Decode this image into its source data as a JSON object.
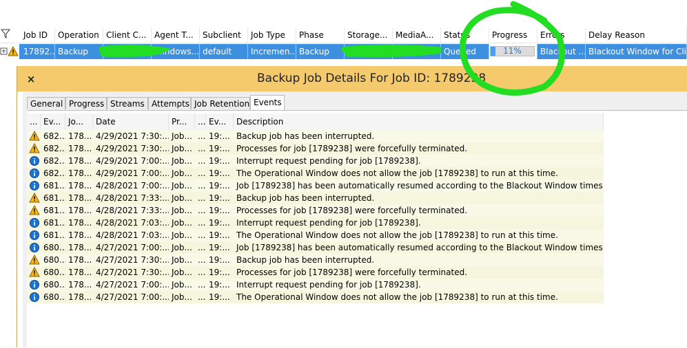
{
  "grid": {
    "columns": [
      "Job ID",
      "Operation",
      "Client C...",
      "Agent T...",
      "Subclient",
      "Job Type",
      "Phase",
      "Storage...",
      "MediaA...",
      "Status",
      "Progress",
      "Errors",
      "Delay Reason"
    ],
    "row": {
      "job_id": "17892...",
      "operation": "Backup",
      "client": "",
      "agent_type": "Windows...",
      "subclient": "default",
      "job_type": "Incremen...",
      "phase": "Backup",
      "storage": "",
      "media_agent": "",
      "status": "Queued",
      "progress": "11%",
      "progress_value": 11,
      "errors": "Blackout ...",
      "delay_reason": "Blackout Window for Client"
    }
  },
  "dialog": {
    "title": "Backup Job Details For Job ID: 1789238",
    "close": "×",
    "tabs": [
      "General",
      "Progress",
      "Streams",
      "Attempts",
      "Job Retention",
      "Events"
    ],
    "active_tab": "Events"
  },
  "events": {
    "columns": [
      "...",
      "Ev...",
      "Jo...",
      "Date",
      "Pr...",
      "...",
      "Ev...",
      "Description"
    ],
    "rows": [
      {
        "sev": "warning",
        "id": "682...",
        "job": "178...",
        "date": "4/29/2021 7:30:...",
        "proc": "Job...",
        "x": "...",
        "ev": "19:...",
        "desc": "Backup job has been interrupted."
      },
      {
        "sev": "warning",
        "id": "682...",
        "job": "178...",
        "date": "4/29/2021 7:30:...",
        "proc": "Job...",
        "x": "...",
        "ev": "19:...",
        "desc": "Processes for job [1789238] were forcefully terminated."
      },
      {
        "sev": "info",
        "id": "682...",
        "job": "178...",
        "date": "4/29/2021 7:00:...",
        "proc": "Job...",
        "x": "...",
        "ev": "19:...",
        "desc": "Interrupt request pending for job [1789238]."
      },
      {
        "sev": "info",
        "id": "682...",
        "job": "178...",
        "date": "4/29/2021 7:00:...",
        "proc": "Job...",
        "x": "...",
        "ev": "19:...",
        "desc": "The Operational Window does not allow the job [1789238] to run at this time."
      },
      {
        "sev": "info",
        "id": "681...",
        "job": "178...",
        "date": "4/28/2021 7:00:...",
        "proc": "Job...",
        "x": "...",
        "ev": "19:...",
        "desc": "Job [1789238] has been automatically resumed according to the Blackout Window times. ..."
      },
      {
        "sev": "warning",
        "id": "681...",
        "job": "178...",
        "date": "4/28/2021 7:33:...",
        "proc": "Job...",
        "x": "...",
        "ev": "19:...",
        "desc": "Backup job has been interrupted."
      },
      {
        "sev": "warning",
        "id": "681...",
        "job": "178...",
        "date": "4/28/2021 7:33:...",
        "proc": "Job...",
        "x": "...",
        "ev": "19:...",
        "desc": "Processes for job [1789238] were forcefully terminated."
      },
      {
        "sev": "info",
        "id": "681...",
        "job": "178...",
        "date": "4/28/2021 7:03:...",
        "proc": "Job...",
        "x": "...",
        "ev": "19:...",
        "desc": "Interrupt request pending for job [1789238]."
      },
      {
        "sev": "info",
        "id": "681...",
        "job": "178...",
        "date": "4/28/2021 7:03:...",
        "proc": "Job...",
        "x": "...",
        "ev": "19:...",
        "desc": "The Operational Window does not allow the job [1789238] to run at this time."
      },
      {
        "sev": "info",
        "id": "680...",
        "job": "178...",
        "date": "4/27/2021 7:00:...",
        "proc": "Job...",
        "x": "...",
        "ev": "19:...",
        "desc": "Job [1789238] has been automatically resumed according to the Blackout Window times. ..."
      },
      {
        "sev": "warning",
        "id": "680...",
        "job": "178...",
        "date": "4/27/2021 7:30:...",
        "proc": "Job...",
        "x": "...",
        "ev": "19:...",
        "desc": "Backup job has been interrupted."
      },
      {
        "sev": "warning",
        "id": "680...",
        "job": "178...",
        "date": "4/27/2021 7:30:...",
        "proc": "Job...",
        "x": "...",
        "ev": "19:...",
        "desc": "Processes for job [1789238] were forcefully terminated."
      },
      {
        "sev": "info",
        "id": "680...",
        "job": "178...",
        "date": "4/27/2021 7:00:...",
        "proc": "Job...",
        "x": "...",
        "ev": "19:...",
        "desc": "Interrupt request pending for job [1789238]."
      },
      {
        "sev": "info",
        "id": "680...",
        "job": "178...",
        "date": "4/27/2021 7:00:...",
        "proc": "Job...",
        "x": "...",
        "ev": "19:...",
        "desc": "The Operational Window does not allow the job [1789238] to run at this time."
      }
    ]
  },
  "colors": {
    "selection": "#3d8fe0",
    "titlebar": "#f5ca6d",
    "annotation": "#22dd22",
    "warning": "#f2b51a",
    "info": "#1e73d2"
  }
}
